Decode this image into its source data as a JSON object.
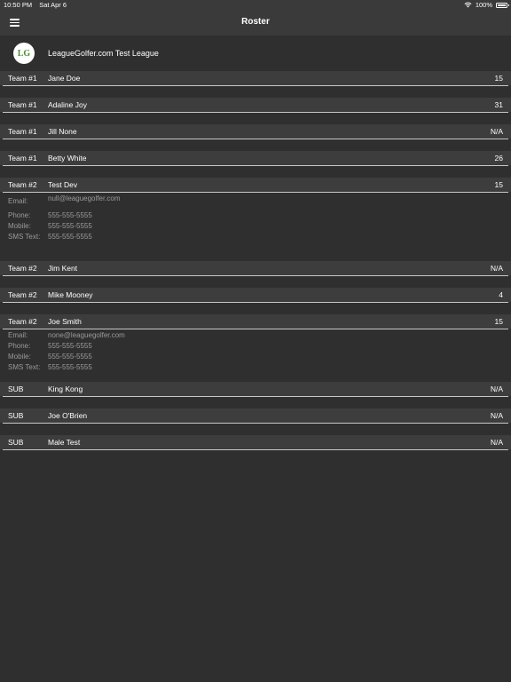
{
  "status": {
    "time": "10:50 PM",
    "date": "Sat Apr 6",
    "battery": "100%",
    "icons": [
      "wifi-icon",
      "battery-icon"
    ]
  },
  "nav": {
    "title": "Roster",
    "menu_icon": "hamburger-menu-icon"
  },
  "league": {
    "name": "LeagueGolfer.com Test League",
    "logo_text": "LG"
  },
  "labels": {
    "email": "Email:",
    "phone": "Phone:",
    "mobile": "Mobile:",
    "sms": "SMS Text:"
  },
  "players": [
    {
      "team": "Team #1",
      "name": "Jane Doe",
      "value": "15"
    },
    {
      "team": "Team #1",
      "name": "Adaline Joy",
      "value": "31"
    },
    {
      "team": "Team #1",
      "name": "Jill None",
      "value": "N/A"
    },
    {
      "team": "Team #1",
      "name": "Betty White",
      "value": "26"
    },
    {
      "team": "Team #2",
      "name": "Test Dev",
      "value": "15",
      "details": {
        "email": "null@leaguegolfer.com",
        "phone": "555-555-5555",
        "mobile": "555-555-5555",
        "sms": "555-555-5555"
      }
    },
    {
      "team": "Team #2",
      "name": "Jim Kent",
      "value": "N/A"
    },
    {
      "team": "Team #2",
      "name": "Mike Mooney",
      "value": "4"
    },
    {
      "team": "Team #2",
      "name": "Joe Smith",
      "value": "15",
      "details": {
        "email": "none@leaguegolfer.com",
        "phone": "555-555-5555",
        "mobile": "555-555-5555",
        "sms": "555-555-5555"
      }
    },
    {
      "team": "SUB",
      "name": "King Kong",
      "value": "N/A"
    },
    {
      "team": "SUB",
      "name": "Joe O'Brien",
      "value": "N/A"
    },
    {
      "team": "SUB",
      "name": "Male Test",
      "value": "N/A"
    }
  ]
}
